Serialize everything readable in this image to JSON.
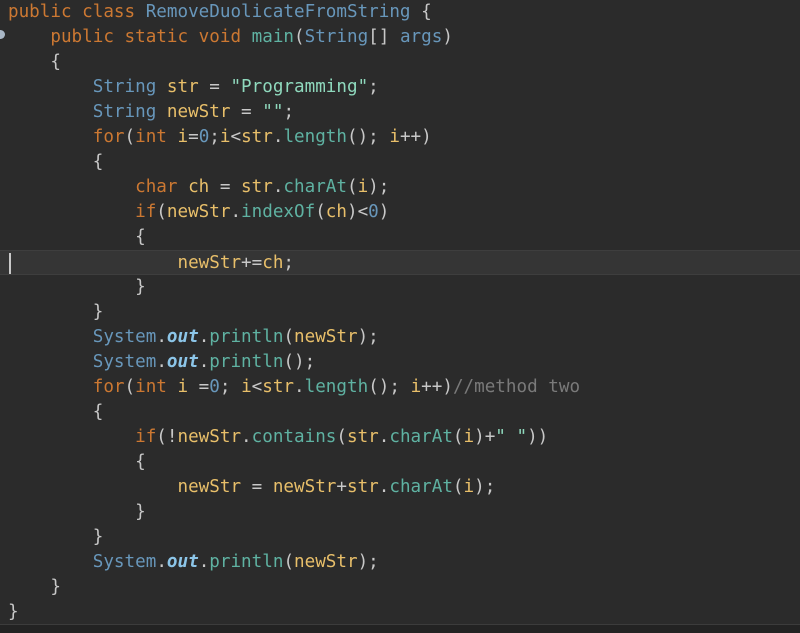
{
  "editor": {
    "colors": {
      "background": "#2b2b2b",
      "keyword": "#cc7832",
      "type": "#6897bb",
      "identifier": "#e8bf6a",
      "method": "#5fb2a2",
      "string": "#8fd9bd",
      "number": "#6897bb",
      "field": "#8cc5e8",
      "comment": "#7a7a7a",
      "punct": "#c8c8c8"
    },
    "current_line_index": 10,
    "lines": [
      [
        [
          "kw",
          "public class "
        ],
        [
          "type",
          "RemoveDuolicateFromString"
        ],
        [
          "p",
          " {"
        ]
      ],
      [
        [
          "p",
          "    "
        ],
        [
          "kw",
          "public static void "
        ],
        [
          "m",
          "main"
        ],
        [
          "p",
          "("
        ],
        [
          "type",
          "String"
        ],
        [
          "p",
          "[] "
        ],
        [
          "type",
          "args"
        ],
        [
          "p",
          ")"
        ]
      ],
      [
        [
          "p",
          "    {"
        ]
      ],
      [
        [
          "p",
          "        "
        ],
        [
          "type",
          "String "
        ],
        [
          "id",
          "str"
        ],
        [
          "p",
          " = "
        ],
        [
          "s",
          "\"Programming\""
        ],
        [
          "p",
          ";"
        ]
      ],
      [
        [
          "p",
          "        "
        ],
        [
          "type",
          "String "
        ],
        [
          "id",
          "newStr"
        ],
        [
          "p",
          " = "
        ],
        [
          "s",
          "\"\""
        ],
        [
          "p",
          ";"
        ]
      ],
      [
        [
          "p",
          "        "
        ],
        [
          "kw",
          "for"
        ],
        [
          "p",
          "("
        ],
        [
          "kw",
          "int "
        ],
        [
          "id",
          "i"
        ],
        [
          "p",
          "="
        ],
        [
          "n",
          "0"
        ],
        [
          "p",
          ";"
        ],
        [
          "id",
          "i"
        ],
        [
          "p",
          "<"
        ],
        [
          "id",
          "str"
        ],
        [
          "p",
          "."
        ],
        [
          "m",
          "length"
        ],
        [
          "p",
          "(); "
        ],
        [
          "id",
          "i"
        ],
        [
          "p",
          "++)"
        ]
      ],
      [
        [
          "p",
          "        {"
        ]
      ],
      [
        [
          "p",
          "            "
        ],
        [
          "kw",
          "char "
        ],
        [
          "id",
          "ch"
        ],
        [
          "p",
          " = "
        ],
        [
          "id",
          "str"
        ],
        [
          "p",
          "."
        ],
        [
          "m",
          "charAt"
        ],
        [
          "p",
          "("
        ],
        [
          "id",
          "i"
        ],
        [
          "p",
          ");"
        ]
      ],
      [
        [
          "p",
          "            "
        ],
        [
          "kw",
          "if"
        ],
        [
          "p",
          "("
        ],
        [
          "id",
          "newStr"
        ],
        [
          "p",
          "."
        ],
        [
          "m",
          "indexOf"
        ],
        [
          "p",
          "("
        ],
        [
          "id",
          "ch"
        ],
        [
          "p",
          ")<"
        ],
        [
          "n",
          "0"
        ],
        [
          "p",
          ")"
        ]
      ],
      [
        [
          "p",
          "            {"
        ]
      ],
      [
        [
          "p",
          "                "
        ],
        [
          "id",
          "newStr"
        ],
        [
          "p",
          "+="
        ],
        [
          "id",
          "ch"
        ],
        [
          "p",
          ";"
        ]
      ],
      [
        [
          "p",
          "            }"
        ]
      ],
      [
        [
          "p",
          "        }"
        ]
      ],
      [
        [
          "p",
          "        "
        ],
        [
          "type",
          "System"
        ],
        [
          "p",
          "."
        ],
        [
          "f",
          "out"
        ],
        [
          "p",
          "."
        ],
        [
          "m",
          "println"
        ],
        [
          "p",
          "("
        ],
        [
          "id",
          "newStr"
        ],
        [
          "p",
          ");"
        ]
      ],
      [
        [
          "p",
          "        "
        ],
        [
          "type",
          "System"
        ],
        [
          "p",
          "."
        ],
        [
          "f",
          "out"
        ],
        [
          "p",
          "."
        ],
        [
          "m",
          "println"
        ],
        [
          "p",
          "();"
        ]
      ],
      [
        [
          "p",
          "        "
        ],
        [
          "kw",
          "for"
        ],
        [
          "p",
          "("
        ],
        [
          "kw",
          "int "
        ],
        [
          "id",
          "i"
        ],
        [
          "p",
          " ="
        ],
        [
          "n",
          "0"
        ],
        [
          "p",
          "; "
        ],
        [
          "id",
          "i"
        ],
        [
          "p",
          "<"
        ],
        [
          "id",
          "str"
        ],
        [
          "p",
          "."
        ],
        [
          "m",
          "length"
        ],
        [
          "p",
          "(); "
        ],
        [
          "id",
          "i"
        ],
        [
          "p",
          "++)"
        ],
        [
          "c",
          "//method two"
        ]
      ],
      [
        [
          "p",
          "        {"
        ]
      ],
      [
        [
          "p",
          "            "
        ],
        [
          "kw",
          "if"
        ],
        [
          "p",
          "(!"
        ],
        [
          "id",
          "newStr"
        ],
        [
          "p",
          "."
        ],
        [
          "m",
          "contains"
        ],
        [
          "p",
          "("
        ],
        [
          "id",
          "str"
        ],
        [
          "p",
          "."
        ],
        [
          "m",
          "charAt"
        ],
        [
          "p",
          "("
        ],
        [
          "id",
          "i"
        ],
        [
          "p",
          ")+"
        ],
        [
          "s",
          "\" \""
        ],
        [
          "p",
          "))"
        ]
      ],
      [
        [
          "p",
          "            {"
        ]
      ],
      [
        [
          "p",
          "                "
        ],
        [
          "id",
          "newStr"
        ],
        [
          "p",
          " = "
        ],
        [
          "id",
          "newStr"
        ],
        [
          "p",
          "+"
        ],
        [
          "id",
          "str"
        ],
        [
          "p",
          "."
        ],
        [
          "m",
          "charAt"
        ],
        [
          "p",
          "("
        ],
        [
          "id",
          "i"
        ],
        [
          "p",
          ");"
        ]
      ],
      [
        [
          "p",
          "            }"
        ]
      ],
      [
        [
          "p",
          "        }"
        ]
      ],
      [
        [
          "p",
          "        "
        ],
        [
          "type",
          "System"
        ],
        [
          "p",
          "."
        ],
        [
          "f",
          "out"
        ],
        [
          "p",
          "."
        ],
        [
          "m",
          "println"
        ],
        [
          "p",
          "("
        ],
        [
          "id",
          "newStr"
        ],
        [
          "p",
          ");"
        ]
      ],
      [
        [
          "p",
          "    }"
        ]
      ],
      [
        [
          "p",
          "}"
        ]
      ]
    ]
  }
}
